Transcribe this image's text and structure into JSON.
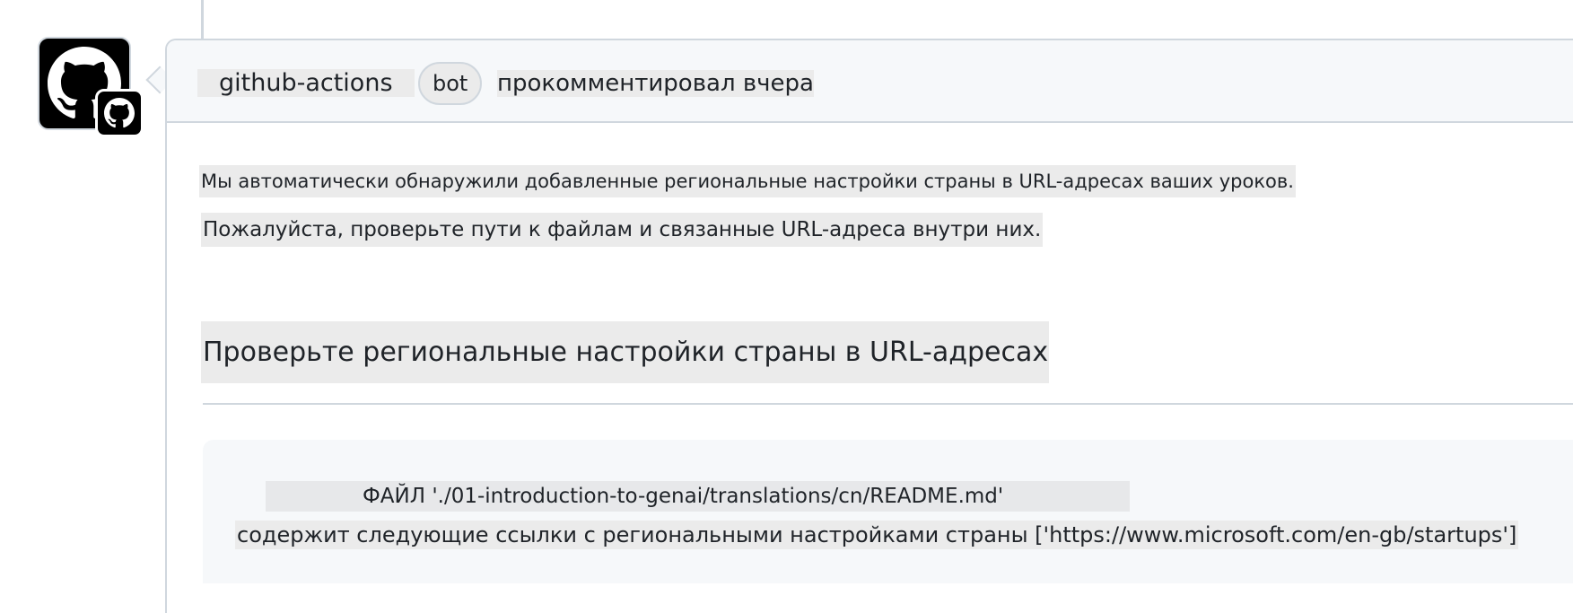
{
  "comment": {
    "author": "github-actions",
    "badge": "bot",
    "action": "прокомментировал вчера",
    "body": {
      "line1": "Мы автоматически обнаружили добавленные региональные настройки страны в URL-адресах ваших уроков.",
      "line2": "Пожалуйста, проверьте пути к файлам и связанные URL-адреса внутри них."
    },
    "heading": "Проверьте региональные настройки страны в URL-адресах",
    "code": {
      "file_line": "ФАЙЛ './01-introduction-to-genai/translations/cn/README.md'",
      "links_line": "содержит следующие ссылки с региональными настройками страны ['https://www.microsoft.com/en-gb/startups']"
    }
  },
  "icons": {
    "avatar": "github-octocat-icon",
    "badge": "github-mark-icon"
  },
  "colors": {
    "border": "#d0d7de",
    "header_bg": "#f6f8fa",
    "highlight": "#ebebeb"
  }
}
